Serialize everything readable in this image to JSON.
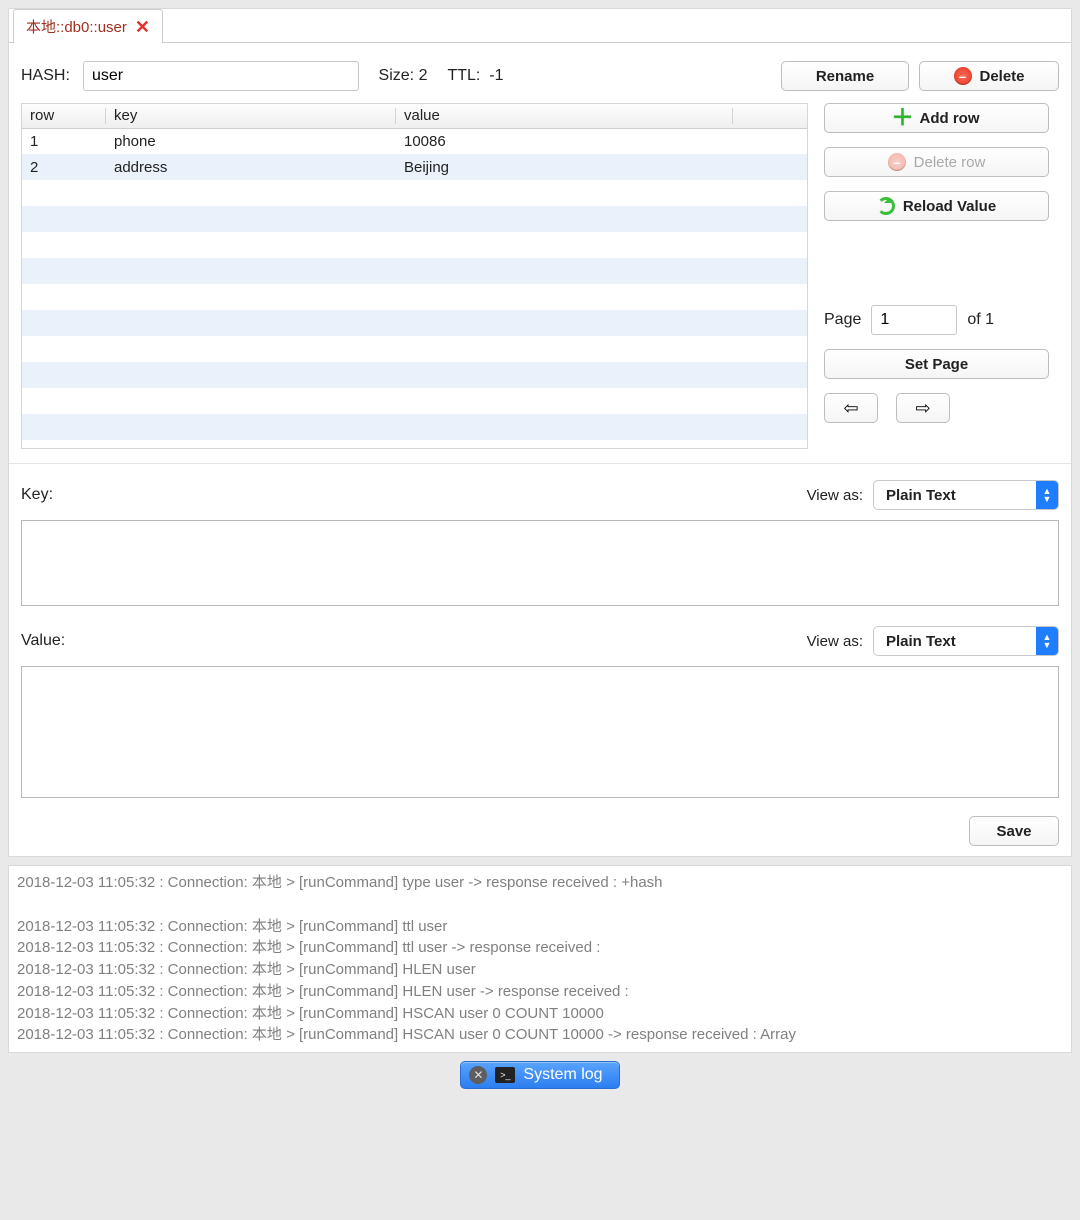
{
  "tab": {
    "title": "本地::db0::user"
  },
  "hash_label": "HASH:",
  "key_name": "user",
  "size_label": "Size:",
  "size_value": "2",
  "ttl_label": "TTL:",
  "ttl_value": "-1",
  "buttons": {
    "rename": "Rename",
    "delete": "Delete",
    "add_row": "Add row",
    "delete_row": "Delete row",
    "reload": "Reload Value",
    "set_page": "Set Page",
    "save": "Save",
    "system_log": "System log"
  },
  "table": {
    "columns": {
      "row": "row",
      "key": "key",
      "value": "value"
    },
    "rows": [
      {
        "row": "1",
        "key": "phone",
        "value": "10086"
      },
      {
        "row": "2",
        "key": "address",
        "value": "Beijing"
      }
    ]
  },
  "pager": {
    "page_label": "Page",
    "page_value": "1",
    "of_label": "of",
    "total": "1"
  },
  "kv": {
    "key_label": "Key:",
    "value_label": "Value:",
    "viewas_label": "View as:",
    "viewas_key_selected": "Plain Text",
    "viewas_value_selected": "Plain Text",
    "key_text": "",
    "value_text": ""
  },
  "log_lines": [
    "2018-12-03 11:05:32 : Connection: 本地 > [runCommand] type user -> response received : +hash",
    "",
    "2018-12-03 11:05:32 : Connection: 本地 > [runCommand] ttl user",
    "2018-12-03 11:05:32 : Connection: 本地 > [runCommand] ttl user -> response received :",
    "2018-12-03 11:05:32 : Connection: 本地 > [runCommand] HLEN user",
    "2018-12-03 11:05:32 : Connection: 本地 > [runCommand] HLEN user -> response received :",
    "2018-12-03 11:05:32 : Connection: 本地 > [runCommand] HSCAN user 0 COUNT 10000",
    "2018-12-03 11:05:32 : Connection: 本地 > [runCommand] HSCAN user 0 COUNT 10000 -> response received : Array"
  ]
}
